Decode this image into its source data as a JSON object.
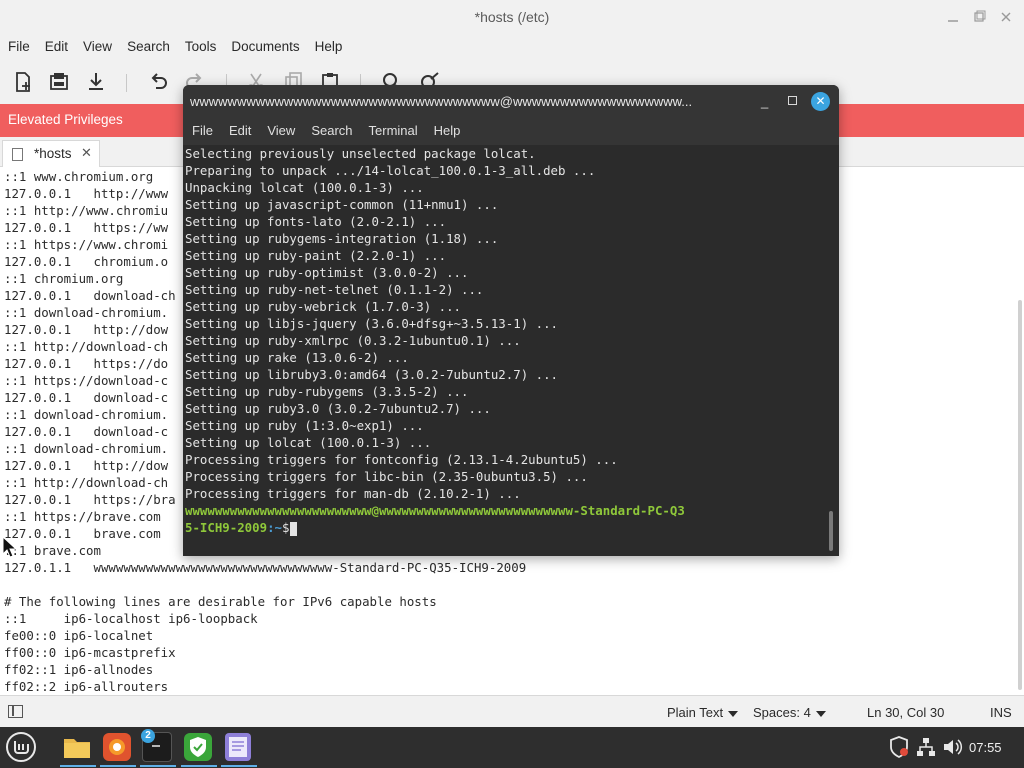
{
  "editor": {
    "title": "*hosts (/etc)",
    "menu": [
      "File",
      "Edit",
      "View",
      "Search",
      "Tools",
      "Documents",
      "Help"
    ],
    "banner": "Elevated Privileges",
    "tab_label": "*hosts",
    "tab_close": "✕",
    "lines": [
      "::1 www.chromium.org",
      "127.0.0.1   http://www",
      "::1 http://www.chromiu",
      "127.0.0.1   https://ww",
      "::1 https://www.chromi",
      "127.0.0.1   chromium.o",
      "::1 chromium.org",
      "127.0.0.1   download-ch",
      "::1 download-chromium.",
      "127.0.0.1   http://dow",
      "::1 http://download-ch",
      "127.0.0.1   https://do",
      "::1 https://download-c",
      "127.0.0.1   download-c",
      "::1 download-chromium.",
      "127.0.0.1   download-c",
      "::1 download-chromium.",
      "127.0.0.1   http://dow",
      "::1 http://download-ch",
      "127.0.0.1   https://bra",
      "::1 https://brave.com",
      "127.0.0.1   brave.com",
      "::1 brave.com",
      "127.0.1.1   wwwwwwwwwwwwwwwwwwwwwwwwwwwwwwww-Standard-PC-Q35-ICH9-2009",
      "",
      "# The following lines are desirable for IPv6 capable hosts",
      "::1     ip6-localhost ip6-loopback",
      "fe00::0 ip6-localnet",
      "ff00::0 ip6-mcastprefix",
      "ff02::1 ip6-allnodes",
      "ff02::2 ip6-allrouters"
    ],
    "status": {
      "language": "Plain Text",
      "spaces": "Spaces: 4",
      "position": "Ln 30, Col 30",
      "mode": "INS"
    }
  },
  "terminal": {
    "title": "wwwwwwwwwwwwwwwwwwwwwwwwwwwwwwwww@wwwwwwwwwwwwwwwwww...",
    "menu": [
      "File",
      "Edit",
      "View",
      "Search",
      "Terminal",
      "Help"
    ],
    "lines": [
      "Selecting previously unselected package lolcat.",
      "Preparing to unpack .../14-lolcat_100.0.1-3_all.deb ...",
      "Unpacking lolcat (100.0.1-3) ...",
      "Setting up javascript-common (11+nmu1) ...",
      "Setting up fonts-lato (2.0-2.1) ...",
      "Setting up rubygems-integration (1.18) ...",
      "Setting up ruby-paint (2.2.0-1) ...",
      "Setting up ruby-optimist (3.0.0-2) ...",
      "Setting up ruby-net-telnet (0.1.1-2) ...",
      "Setting up ruby-webrick (1.7.0-3) ...",
      "Setting up libjs-jquery (3.6.0+dfsg+~3.5.13-1) ...",
      "Setting up ruby-xmlrpc (0.3.2-1ubuntu0.1) ...",
      "Setting up rake (13.0.6-2) ...",
      "Setting up libruby3.0:amd64 (3.0.2-7ubuntu2.7) ...",
      "Setting up ruby-rubygems (3.3.5-2) ...",
      "Setting up ruby3.0 (3.0.2-7ubuntu2.7) ...",
      "Setting up ruby (1:3.0~exp1) ...",
      "Setting up lolcat (100.0.1-3) ...",
      "Processing triggers for fontconfig (2.13.1-4.2ubuntu5) ...",
      "Processing triggers for libc-bin (2.35-0ubuntu3.5) ...",
      "Processing triggers for man-db (2.10.2-1) ..."
    ],
    "prompt_line1": "wwwwwwwwwwwwwwwwwwwwwwwww@wwwwwwwwwwwwwwwwwwwwwwwwww-Standard-PC-Q3",
    "prompt_line2_user": "5-ICH9-2009",
    "prompt_path": ":~",
    "prompt_dollar": "$"
  },
  "taskbar": {
    "clock": "07:55",
    "terminal_badge": "2"
  },
  "colors": {
    "banner": "#f05e5e",
    "terminal_bg": "#2b2b2b",
    "prompt_user": "#8fc83a",
    "prompt_path": "#4b9cd3",
    "close_button": "#3ba4e0"
  }
}
